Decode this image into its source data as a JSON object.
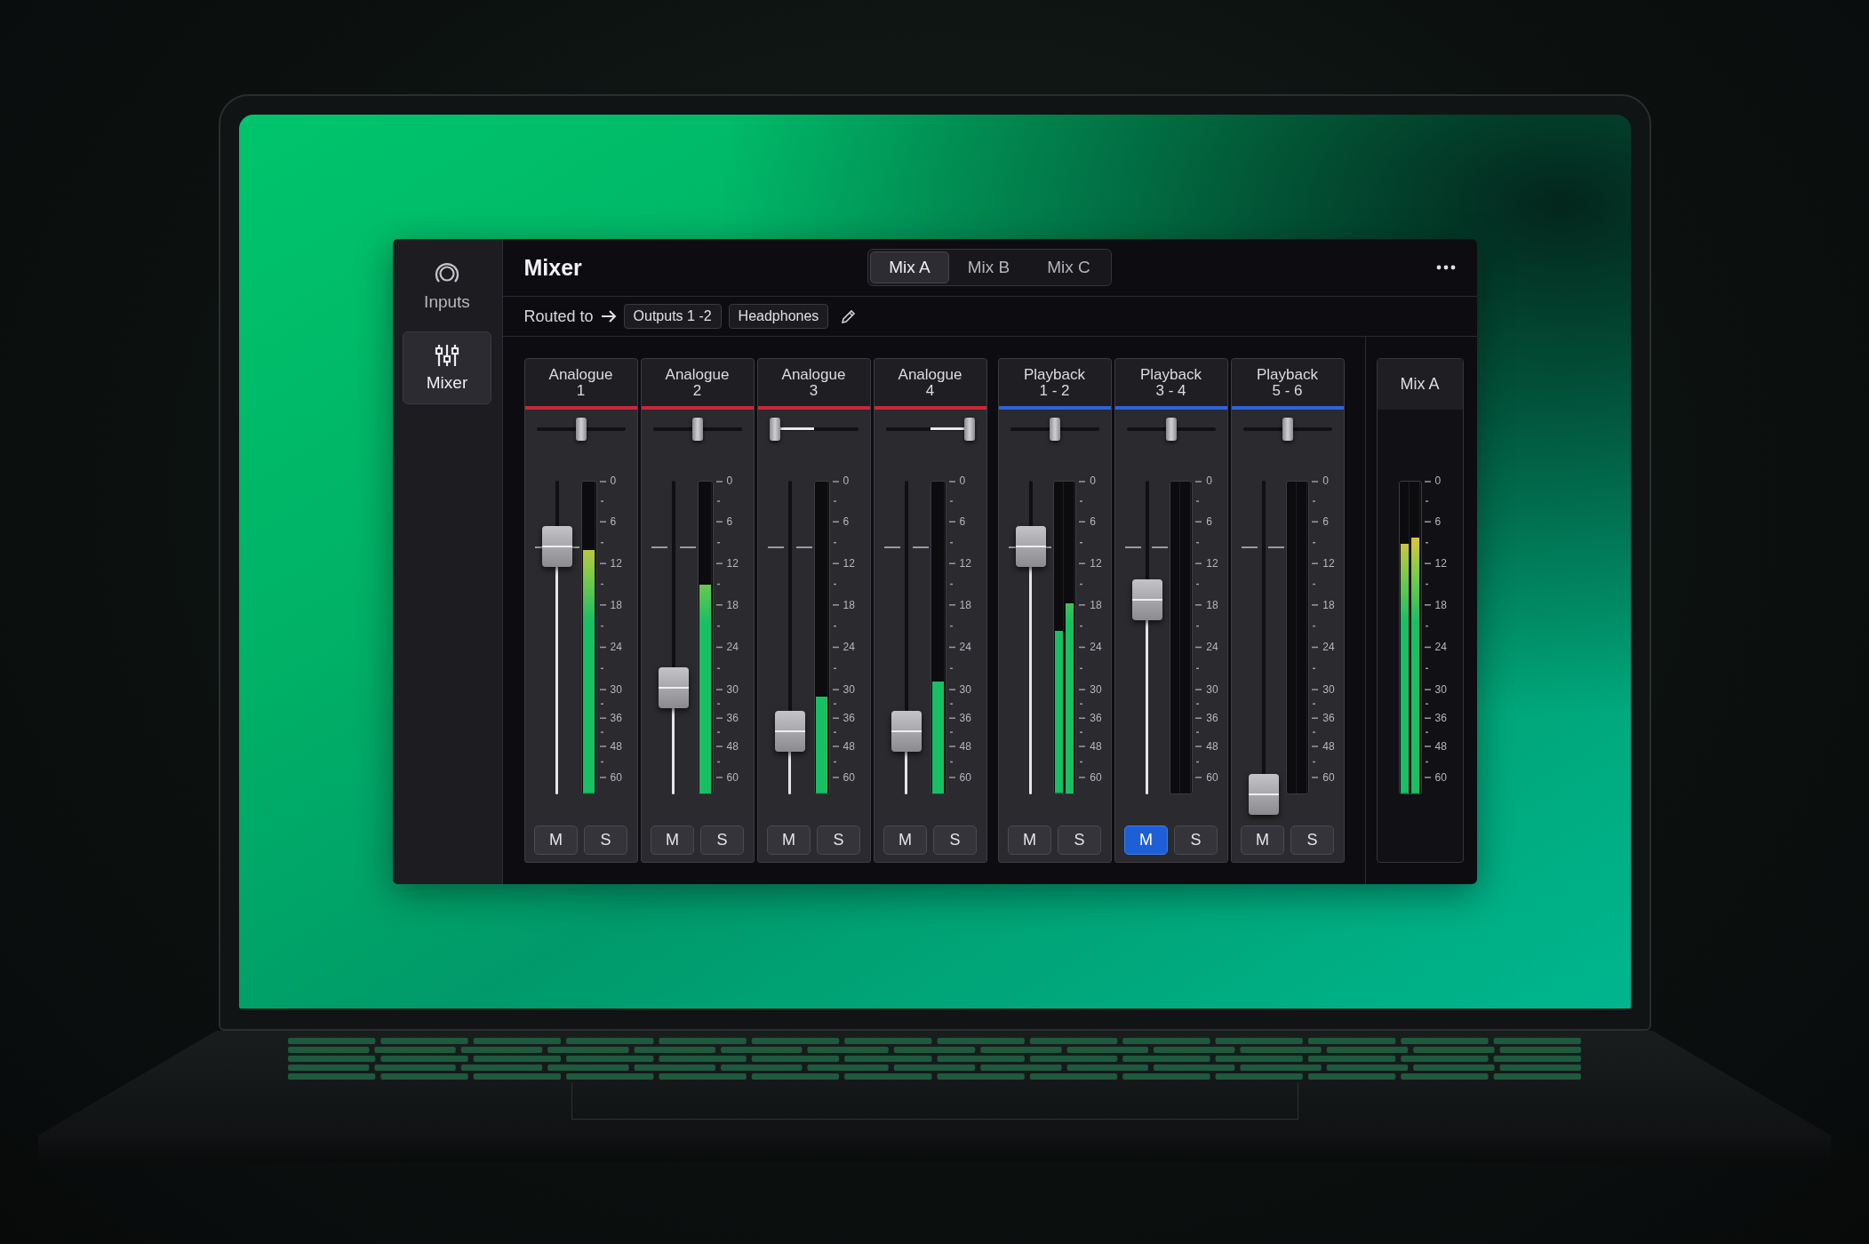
{
  "sidebar": {
    "items": [
      {
        "kind": "inputs",
        "label": "Inputs",
        "selected": false
      },
      {
        "kind": "mixer",
        "label": "Mixer",
        "selected": true
      }
    ]
  },
  "header": {
    "title": "Mixer",
    "tabs": [
      {
        "label": "Mix A",
        "selected": true
      },
      {
        "label": "Mix B",
        "selected": false
      },
      {
        "label": "Mix C",
        "selected": false
      }
    ]
  },
  "routing": {
    "label": "Routed to",
    "outputs": [
      "Outputs 1 -2",
      "Headphones"
    ]
  },
  "channel_groups": [
    {
      "channels": [
        {
          "name": "Analogue\n1",
          "color": "#c8283a",
          "pan": {
            "level": 0.5
          },
          "fader": {
            "level": 0.79
          },
          "meter": [
            {
              "level": 0.78
            }
          ],
          "scale": [
            "0",
            "6",
            "12",
            "18",
            "24",
            "30",
            "36",
            "48",
            "60"
          ],
          "mute": {
            "label": "M",
            "on": false
          },
          "solo": {
            "label": "S",
            "on": false
          }
        },
        {
          "name": "Analogue\n2",
          "color": "#c8283a",
          "pan": {
            "level": 0.5
          },
          "fader": {
            "level": 0.34
          },
          "meter": [
            {
              "level": 0.67
            }
          ],
          "scale": [
            "0",
            "6",
            "12",
            "18",
            "24",
            "30",
            "36",
            "48",
            "60"
          ],
          "mute": {
            "label": "M",
            "on": false
          },
          "solo": {
            "label": "S",
            "on": false
          }
        },
        {
          "name": "Analogue\n3",
          "color": "#c8283a",
          "pan": {
            "level": 0.0
          },
          "fader": {
            "level": 0.2
          },
          "meter": [
            {
              "level": 0.31
            }
          ],
          "scale": [
            "0",
            "6",
            "12",
            "18",
            "24",
            "30",
            "36",
            "48",
            "60"
          ],
          "mute": {
            "label": "M",
            "on": false
          },
          "solo": {
            "label": "S",
            "on": false
          }
        },
        {
          "name": "Analogue\n4",
          "color": "#c8283a",
          "pan": {
            "level": 1.0
          },
          "fader": {
            "level": 0.2
          },
          "meter": [
            {
              "level": 0.36
            }
          ],
          "scale": [
            "0",
            "6",
            "12",
            "18",
            "24",
            "30",
            "36",
            "48",
            "60"
          ],
          "mute": {
            "label": "M",
            "on": false
          },
          "solo": {
            "label": "S",
            "on": false
          }
        }
      ]
    },
    {
      "channels": [
        {
          "name": "Playback\n1 - 2",
          "color": "#2f63d9",
          "pan": {
            "level": 0.5
          },
          "fader": {
            "level": 0.79
          },
          "meter": [
            {
              "level": 0.52
            },
            {
              "level": 0.61
            }
          ],
          "scale": [
            "0",
            "6",
            "12",
            "18",
            "24",
            "30",
            "36",
            "48",
            "60"
          ],
          "mute": {
            "label": "M",
            "on": false
          },
          "solo": {
            "label": "S",
            "on": false
          }
        },
        {
          "name": "Playback\n3 - 4",
          "color": "#2f63d9",
          "pan": {
            "level": 0.5
          },
          "fader": {
            "level": 0.62
          },
          "meter": [
            {
              "level": 0
            },
            {
              "level": 0
            }
          ],
          "scale": [
            "0",
            "6",
            "12",
            "18",
            "24",
            "30",
            "36",
            "48",
            "60"
          ],
          "mute": {
            "label": "M",
            "on": true
          },
          "solo": {
            "label": "S",
            "on": false
          }
        },
        {
          "name": "Playback\n5 - 6",
          "color": "#2f63d9",
          "pan": {
            "level": 0.5
          },
          "fader": {
            "level": 0.0
          },
          "meter": [
            {
              "level": 0
            },
            {
              "level": 0
            }
          ],
          "scale": [
            "0",
            "6",
            "12",
            "18",
            "24",
            "30",
            "36",
            "48",
            "60"
          ],
          "mute": {
            "label": "M",
            "on": false
          },
          "solo": {
            "label": "S",
            "on": false
          }
        }
      ]
    }
  ],
  "master": {
    "name": "Mix A",
    "meter": [
      {
        "level": 0.8
      },
      {
        "level": 0.82
      }
    ],
    "scale": [
      "0",
      "6",
      "12",
      "18",
      "24",
      "30",
      "36",
      "48",
      "60"
    ]
  }
}
